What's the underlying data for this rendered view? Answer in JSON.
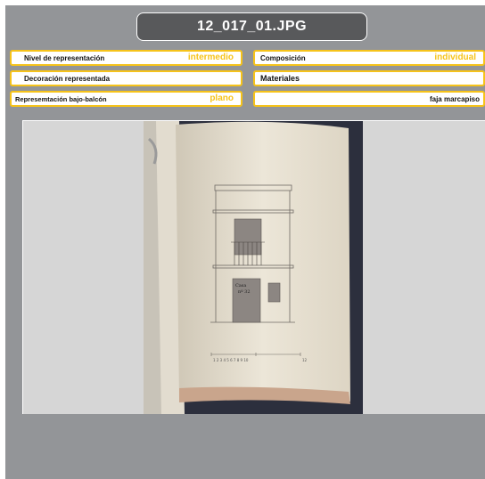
{
  "title": "12_017_01.JPG",
  "fields": {
    "nivel": {
      "label": "Nivel de representación",
      "value": "intermedio"
    },
    "composicion": {
      "label": "Composición",
      "value": "individual"
    },
    "decoracion": {
      "label": "Decoración representada",
      "value": ""
    },
    "materiales": {
      "label": "Materiales",
      "value": ""
    },
    "bajo_balcon": {
      "label": "Represemtación bajo-balcón",
      "value": "plano"
    },
    "extra": {
      "label": "",
      "value": "faja marcapiso"
    }
  },
  "drawing": {
    "annotation_line1": "Casa",
    "annotation_line2": "nº 32",
    "scale_text": "1 2 3 4 5 6 7 8 9 10",
    "scale_end": "12"
  },
  "colors": {
    "accent": "#f6c31a",
    "panel": "#939598",
    "title_bg": "#58595b"
  }
}
